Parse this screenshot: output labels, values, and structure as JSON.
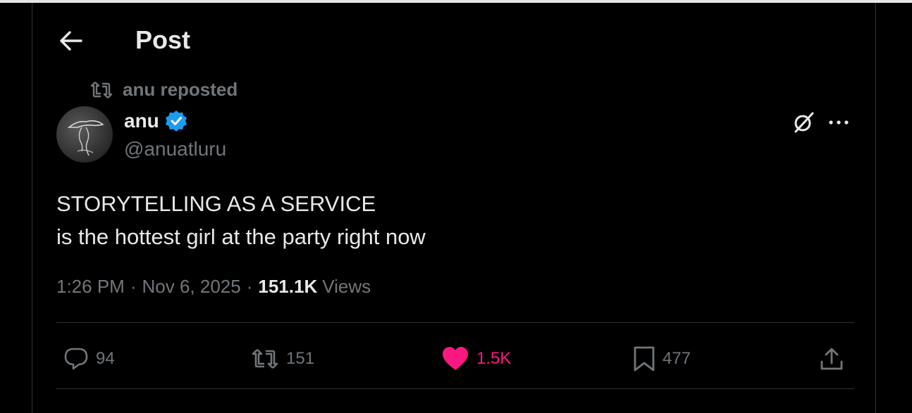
{
  "header": {
    "title": "Post",
    "back_icon": "arrow-left-icon"
  },
  "repost": {
    "text": "anu reposted"
  },
  "author": {
    "display_name": "anu",
    "handle": "@anuatluru",
    "verified": true
  },
  "post": {
    "lines": [
      "STORYTELLING AS A SERVICE",
      "is the hottest girl at the party right now"
    ]
  },
  "meta": {
    "time": "1:26 PM",
    "date": "Nov 6, 2025",
    "views_count": "151.1K",
    "views_label": "Views",
    "separator": "·"
  },
  "actions": {
    "replies": "94",
    "reposts": "151",
    "likes": "1.5K",
    "bookmarks": "477"
  },
  "colors": {
    "background": "#000000",
    "text": "#e7e9ea",
    "muted": "#71767b",
    "like": "#f91880",
    "verified": "#1d9bf0",
    "border": "#2f3336"
  }
}
